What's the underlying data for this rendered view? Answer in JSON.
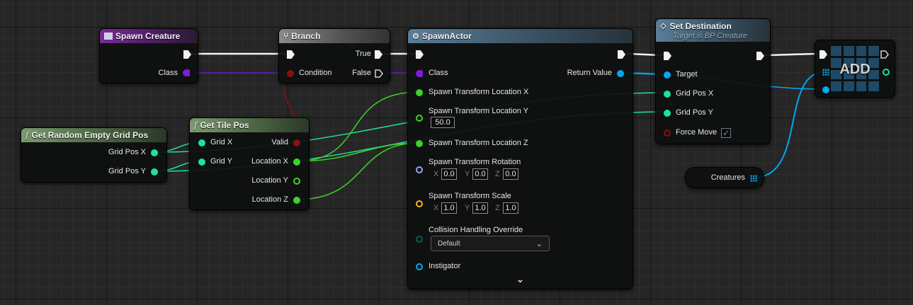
{
  "nodes": {
    "spawn_creature": {
      "title": "Spawn Creature",
      "class_label": "Class"
    },
    "branch": {
      "title": "Branch",
      "condition": "Condition",
      "true_label": "True",
      "false_label": "False"
    },
    "spawn_actor": {
      "title": "SpawnActor",
      "class_label": "Class",
      "return_value": "Return Value",
      "loc_x": "Spawn Transform Location X",
      "loc_y": "Spawn Transform Location Y",
      "loc_y_value": "50.0",
      "loc_z": "Spawn Transform Location Z",
      "rotation": "Spawn Transform Rotation",
      "rotation_values": {
        "x": "0.0",
        "y": "0.0",
        "z": "0.0"
      },
      "scale": "Spawn Transform Scale",
      "scale_values": {
        "x": "1.0",
        "y": "1.0",
        "z": "1.0"
      },
      "axis_labels": {
        "x": "X",
        "y": "Y",
        "z": "Z"
      },
      "collision": "Collision Handling Override",
      "collision_value": "Default",
      "instigator": "Instigator"
    },
    "set_destination": {
      "title": "Set Destination",
      "subtitle": "Target is BP Creature",
      "target": "Target",
      "grid_pos_x": "Grid Pos X",
      "grid_pos_y": "Grid Pos Y",
      "force_move": "Force Move",
      "force_move_checked": true
    },
    "add": {
      "title": "ADD"
    },
    "get_random_empty_grid_pos": {
      "title": "Get Random Empty Grid Pos",
      "grid_pos_x": "Grid Pos X",
      "grid_pos_y": "Grid Pos Y"
    },
    "get_tile_pos": {
      "title": "Get Tile Pos",
      "grid_x": "Grid X",
      "grid_y": "Grid Y",
      "valid": "Valid",
      "location_x": "Location X",
      "location_y": "Location Y",
      "location_z": "Location Z"
    },
    "creatures": {
      "label": "Creatures"
    }
  },
  "pin_colors": {
    "exec": "#f2f2f2",
    "class": "#7a1fd6",
    "bool": "#8c0f0f",
    "float": "#3fd12a",
    "integer": "#1fe0a5",
    "object": "#00a8f3",
    "rotator": "#9aa5ff",
    "vector": "#f0b62a",
    "enum": "#0a5c5c"
  },
  "icons": {
    "event": "event-icon",
    "branch": "branch-icon",
    "spawn": "spawn-actor-icon",
    "function": "function-icon",
    "set": "diamond-icon",
    "array": "array-icon",
    "dropdown": "chevron-down-icon",
    "expand": "expand-chevron-icon",
    "check": "checkmark-icon"
  }
}
